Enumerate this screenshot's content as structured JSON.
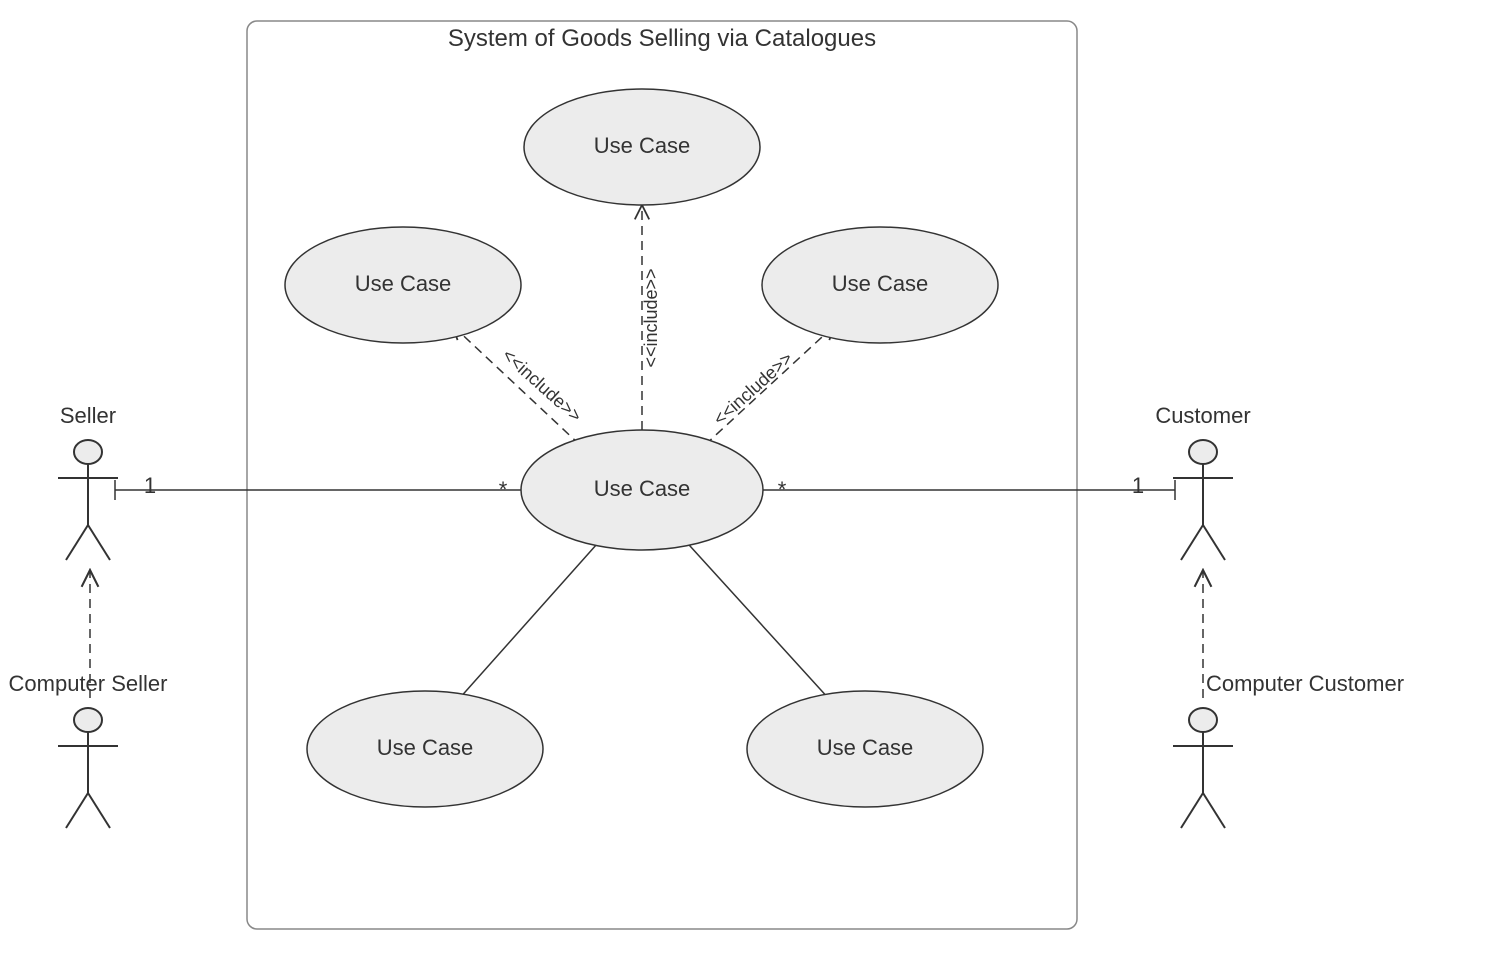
{
  "system": {
    "title": "System of Goods Selling via Catalogues"
  },
  "useCases": {
    "top": {
      "label": "Use Case"
    },
    "left": {
      "label": "Use Case"
    },
    "right": {
      "label": "Use Case"
    },
    "center": {
      "label": "Use Case"
    },
    "botLeft": {
      "label": "Use Case"
    },
    "botRight": {
      "label": "Use Case"
    }
  },
  "actors": {
    "seller": {
      "label": "Seller"
    },
    "computerSeller": {
      "label": "Computer Seller"
    },
    "customer": {
      "label": "Customer"
    },
    "computerCustomer": {
      "label": "Computer Customer"
    }
  },
  "multiplicities": {
    "sellerEnd": "1",
    "centerLeft": "*",
    "centerRight": "*",
    "customerEnd": "1"
  },
  "stereotypes": {
    "includeLeft": "<<include>>",
    "includeMid": "<<include>>",
    "includeRight": "<<include>>"
  }
}
